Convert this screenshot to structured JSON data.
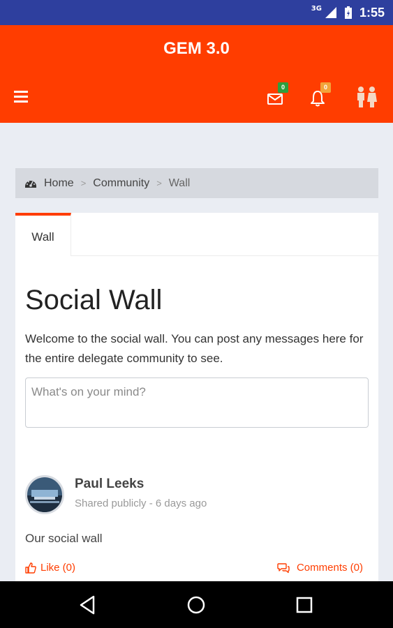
{
  "status_bar": {
    "network": "3G",
    "time": "1:55"
  },
  "app": {
    "title": "GEM 3.0",
    "accent_color": "#ff3d00",
    "icons": {
      "menu": "hamburger-icon",
      "messages": "envelope-icon",
      "notifications": "bell-icon",
      "people": "people-icon"
    },
    "messages_badge": "0",
    "messages_badge_color": "#2e9e3e",
    "notifications_badge": "0",
    "notifications_badge_color": "#f2a33a"
  },
  "breadcrumb": {
    "icon": "dashboard-icon",
    "items": [
      "Home",
      "Community",
      "Wall"
    ],
    "separator": ">"
  },
  "tabs": [
    {
      "label": "Wall",
      "active": true
    }
  ],
  "page": {
    "title": "Social Wall",
    "intro": "Welcome to the social wall. You can post any messages here for the entire delegate community to see.",
    "input_placeholder": "What's on your mind?"
  },
  "posts": [
    {
      "author": "Paul Leeks",
      "meta": "Shared publicly - 6 days ago",
      "body": "Our social wall",
      "like_label": "Like (0)",
      "comments_label": "Comments (0)"
    }
  ]
}
